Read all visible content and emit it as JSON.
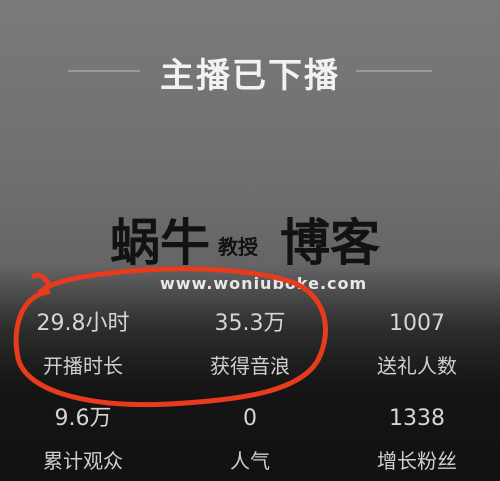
{
  "header": {
    "title": "主播已下播"
  },
  "watermark": {
    "name_part1": "蜗牛",
    "name_part2": "教授",
    "name_part3": "博客",
    "url": "www.woniuboke.com"
  },
  "stats": [
    {
      "value": "29.8小时",
      "label": "开播时长"
    },
    {
      "value": "35.3万",
      "label": "获得音浪"
    },
    {
      "value": "1007",
      "label": "送礼人数"
    },
    {
      "value": "9.6万",
      "label": "累计观众"
    },
    {
      "value": "0",
      "label": "人气"
    },
    {
      "value": "1338",
      "label": "增长粉丝"
    }
  ],
  "colors": {
    "annotation": "#e83a1c"
  }
}
